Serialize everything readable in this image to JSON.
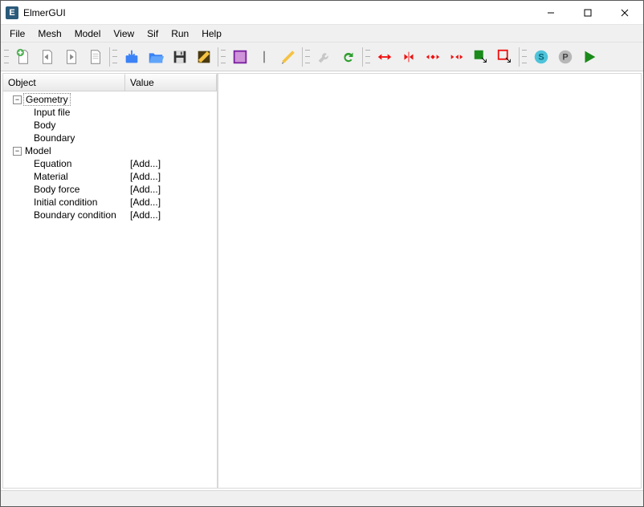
{
  "window": {
    "title": "ElmerGUI",
    "app_icon_letter": "E"
  },
  "menu": {
    "items": [
      "File",
      "Mesh",
      "Model",
      "View",
      "Sif",
      "Run",
      "Help"
    ]
  },
  "side": {
    "col_object": "Object",
    "col_value": "Value",
    "tree": {
      "geometry": {
        "label": "Geometry",
        "children": {
          "input_file": "Input file",
          "body": "Body",
          "boundary": "Boundary"
        }
      },
      "model": {
        "label": "Model",
        "children": {
          "equation": {
            "label": "Equation",
            "value": "[Add...]"
          },
          "material": {
            "label": "Material",
            "value": "[Add...]"
          },
          "body_force": {
            "label": "Body force",
            "value": "[Add...]"
          },
          "initial": {
            "label": "Initial condition",
            "value": "[Add...]"
          },
          "bc": {
            "label": "Boundary condition",
            "value": "[Add...]"
          }
        }
      }
    }
  },
  "toolbar_names": [
    "new-file",
    "back-page",
    "forward-page",
    "document",
    "load-blue",
    "open-folder",
    "save",
    "edit-pencil",
    "view-purple",
    "divider",
    "pencil",
    "wrench",
    "redo-green",
    "expand-horiz",
    "collapse-horiz",
    "expand-both",
    "collapse-both",
    "select-green",
    "select-red",
    "s-button",
    "p-button",
    "run-green"
  ]
}
